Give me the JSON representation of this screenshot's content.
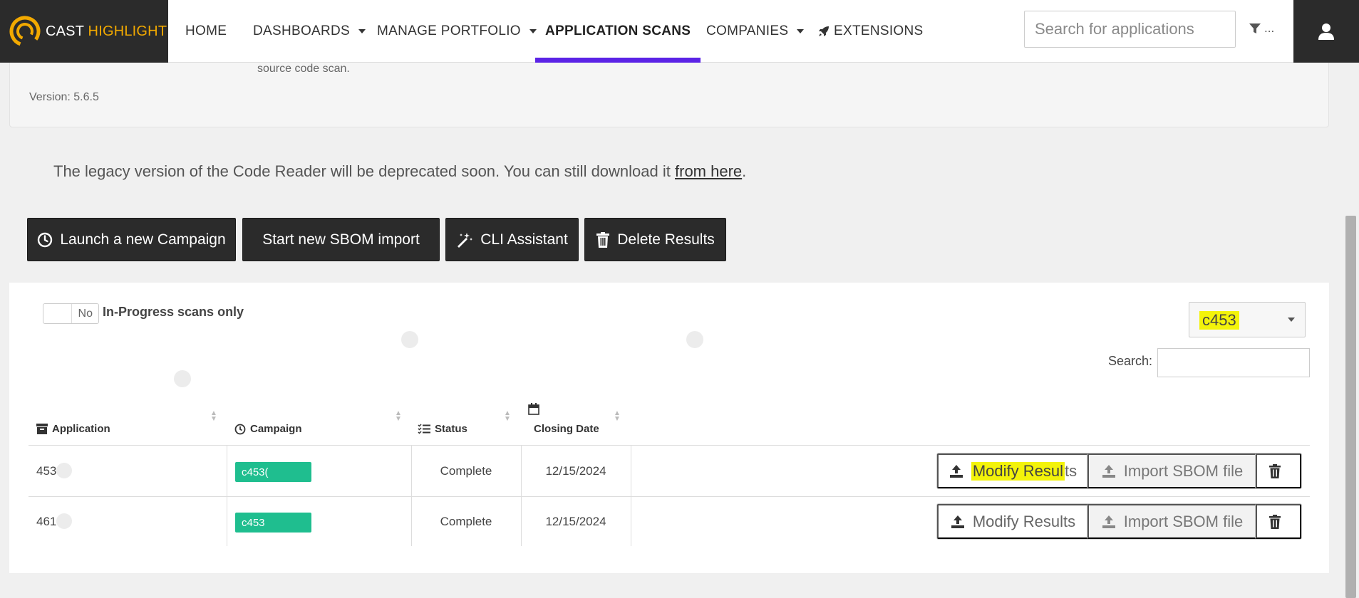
{
  "brand": {
    "name_part1": "CAST",
    "name_part2": "HIGHLIGHT",
    "accent": "#f2a900"
  },
  "nav": {
    "items": [
      {
        "label": "HOME"
      },
      {
        "label": "DASHBOARDS"
      },
      {
        "label": "MANAGE PORTFOLIO"
      },
      {
        "label": "APPLICATION SCANS"
      },
      {
        "label": "COMPANIES"
      },
      {
        "label": "EXTENSIONS"
      }
    ],
    "active_item": "APPLICATION SCANS",
    "active_color": "#5b23e6",
    "search_placeholder": "Search for applications",
    "filter_label": "..."
  },
  "info": {
    "description_fragment": "source code scan.",
    "version": "Version: 5.6.5"
  },
  "notice": {
    "text": "The legacy version of the Code Reader will be deprecated soon. You can still download it ",
    "link_text": "from here",
    "end": "."
  },
  "actions": {
    "launch_campaign": "Launch a new Campaign",
    "sbom_import": "Start new SBOM import",
    "cli_assistant": "CLI Assistant",
    "delete_results": "Delete Results"
  },
  "filters": {
    "toggle_value": "No",
    "toggle_label": "In-Progress scans only",
    "campaign_selected": "c453",
    "search_label": "Search:"
  },
  "table": {
    "columns": [
      "Application",
      "Campaign",
      "Status",
      "Closing Date"
    ],
    "rows": [
      {
        "application": "453",
        "campaign": "c453(",
        "status": "Complete",
        "closing_date": "12/15/2024"
      },
      {
        "application": "461",
        "campaign": "c453",
        "status": "Complete",
        "closing_date": "12/15/2024"
      }
    ],
    "row_actions": {
      "modify_label": "Modify Results",
      "modify_highlight": "Modify Resul",
      "modify_rest": "ts",
      "import_label": "Import SBOM file"
    },
    "status_pill_color": "#1fbe8f"
  },
  "highlight_color": "#f3f30a"
}
